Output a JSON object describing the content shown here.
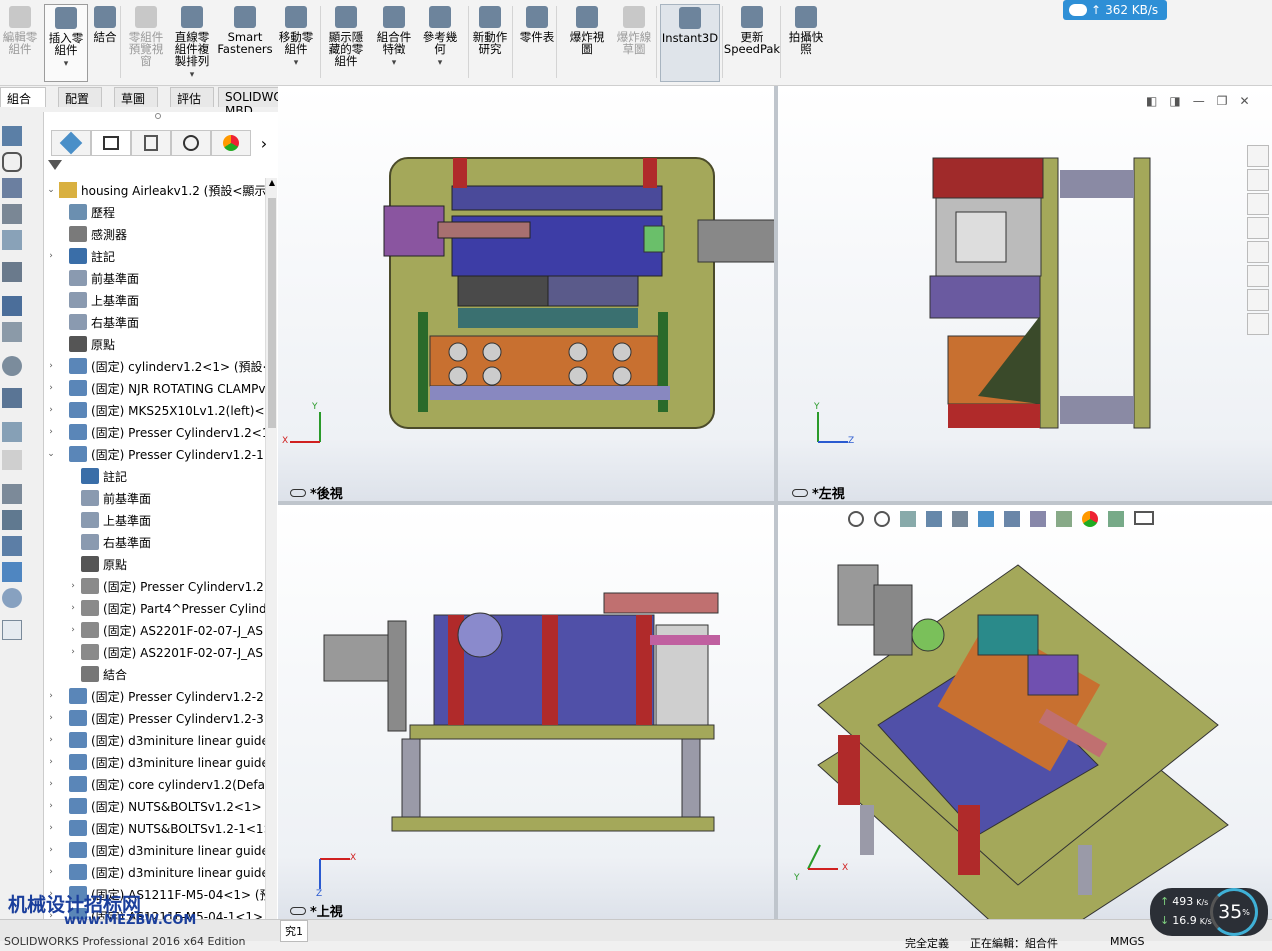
{
  "ribbon": {
    "buttons": [
      {
        "label": "編輯零\n組件",
        "icon": "edit-component-icon",
        "disabled": true
      },
      {
        "label": "插入零\n組件",
        "icon": "insert-component-icon",
        "disabled": false
      },
      {
        "label": "結合",
        "icon": "mate-icon",
        "disabled": false
      },
      {
        "label": "零組件\n預覽視\n窗",
        "icon": "component-preview-icon",
        "disabled": true
      },
      {
        "label": "直線零\n組件複\n製排列",
        "icon": "linear-pattern-icon",
        "disabled": false
      },
      {
        "label": "Smart\nFasteners",
        "icon": "smart-fasteners-icon",
        "disabled": false
      },
      {
        "label": "移動零\n組件",
        "icon": "move-component-icon",
        "disabled": false
      },
      {
        "label": "顯示隱\n藏的零\n組件",
        "icon": "show-hidden-icon",
        "disabled": false
      },
      {
        "label": "組合件\n特徵",
        "icon": "assembly-feature-icon",
        "disabled": false
      },
      {
        "label": "參考幾\n何",
        "icon": "reference-geometry-icon",
        "disabled": false
      },
      {
        "label": "新動作\n研究",
        "icon": "motion-study-icon",
        "disabled": false
      },
      {
        "label": "零件表",
        "icon": "bom-icon",
        "disabled": false
      },
      {
        "label": "爆炸視\n圖",
        "icon": "exploded-view-icon",
        "disabled": false
      },
      {
        "label": "爆炸線\n草圖",
        "icon": "explode-line-icon",
        "disabled": true
      },
      {
        "label": "Instant3D",
        "icon": "instant3d-icon",
        "disabled": false
      },
      {
        "label": "更新\nSpeedPak",
        "icon": "speedpak-icon",
        "disabled": false
      },
      {
        "label": "拍攝快\n照",
        "icon": "snapshot-icon",
        "disabled": false
      }
    ],
    "net_speed": "362 KB/s"
  },
  "tabs": [
    "組合件",
    "配置",
    "草圖",
    "評估",
    "SOLIDWORKS MBD"
  ],
  "tree": {
    "root": "housing Airleakv1.2 (預設<顯示狀態",
    "nodes": [
      {
        "label": "歷程",
        "icon": "history-icon",
        "level": 1
      },
      {
        "label": "感測器",
        "icon": "sensor-icon",
        "level": 1
      },
      {
        "label": "註記",
        "icon": "annotation-icon",
        "level": 1,
        "exp": "›"
      },
      {
        "label": "前基準面",
        "icon": "plane-icon",
        "level": 1
      },
      {
        "label": "上基準面",
        "icon": "plane-icon",
        "level": 1
      },
      {
        "label": "右基準面",
        "icon": "plane-icon",
        "level": 1
      },
      {
        "label": "原點",
        "icon": "origin-icon",
        "level": 1
      },
      {
        "label": "(固定) cylinderv1.2<1> (預設<顯",
        "icon": "part-icon",
        "level": 1,
        "exp": "›"
      },
      {
        "label": "(固定) NJR ROTATING CLAMPv",
        "icon": "part-icon",
        "level": 1,
        "exp": "›"
      },
      {
        "label": "(固定) MKS25X10Lv1.2(left)<1>",
        "icon": "part-icon",
        "level": 1,
        "exp": "›"
      },
      {
        "label": "(固定) Presser Cylinderv1.2<1>",
        "icon": "part-icon",
        "level": 1,
        "exp": "›"
      },
      {
        "label": "(固定) Presser Cylinderv1.2-1<1",
        "icon": "part-icon",
        "level": 1,
        "exp": "⌄"
      },
      {
        "label": "註記",
        "icon": "annotation-icon",
        "level": 2
      },
      {
        "label": "前基準面",
        "icon": "plane-icon",
        "level": 2
      },
      {
        "label": "上基準面",
        "icon": "plane-icon",
        "level": 2
      },
      {
        "label": "右基準面",
        "icon": "plane-icon",
        "level": 2
      },
      {
        "label": "原點",
        "icon": "origin-icon",
        "level": 2
      },
      {
        "label": "(固定) Presser Cylinderv1.2<",
        "icon": "subpart-icon",
        "level": 2,
        "exp": "›"
      },
      {
        "label": "(固定) Part4^Presser Cylind",
        "icon": "subpart-icon",
        "level": 2,
        "exp": "›"
      },
      {
        "label": "(固定) AS2201F-02-07-J_AS",
        "icon": "subpart-icon",
        "level": 2,
        "exp": "›"
      },
      {
        "label": "(固定) AS2201F-02-07-J_AS",
        "icon": "subpart-icon",
        "level": 2,
        "exp": "›"
      },
      {
        "label": "結合",
        "icon": "mate-icon",
        "level": 2
      },
      {
        "label": "(固定) Presser Cylinderv1.2-2<1",
        "icon": "part-icon",
        "level": 1,
        "exp": "›"
      },
      {
        "label": "(固定) Presser Cylinderv1.2-3<1",
        "icon": "part-icon",
        "level": 1,
        "exp": "›"
      },
      {
        "label": "(固定) d3miniture linear guide.3",
        "icon": "part-icon",
        "level": 1,
        "exp": "›"
      },
      {
        "label": "(固定) d3miniture linear guide.3",
        "icon": "part-icon",
        "level": 1,
        "exp": "›"
      },
      {
        "label": "(固定) core cylinderv1.2(Default",
        "icon": "part-icon",
        "level": 1,
        "exp": "›"
      },
      {
        "label": "(固定) NUTS&BOLTSv1.2<1> (預",
        "icon": "part-icon",
        "level": 1,
        "exp": "›"
      },
      {
        "label": "(固定) NUTS&BOLTSv1.2-1<1>",
        "icon": "part-icon",
        "level": 1,
        "exp": "›"
      },
      {
        "label": "(固定) d3miniture linear guide.3",
        "icon": "part-icon",
        "level": 1,
        "exp": "›"
      },
      {
        "label": "(固定) d3miniture linear guide.3",
        "icon": "part-icon",
        "level": 1,
        "exp": "›"
      },
      {
        "label": "(固定) AS1211F-M5-04<1> (預設",
        "icon": "part-icon",
        "level": 1,
        "exp": "›"
      },
      {
        "label": "(固定) AS1211F-M5-04-1<1> (",
        "icon": "part-icon",
        "level": 1,
        "exp": "›"
      }
    ]
  },
  "views": {
    "back": "*後視",
    "left": "*左視",
    "top": "*上視"
  },
  "status": {
    "study": "究1",
    "left": "SOLIDWORKS Professional 2016 x64 Edition",
    "mid": "完全定義",
    "edit": "正在編輯：組合件",
    "units": "MMGS"
  },
  "hud": {
    "up": "493",
    "down": "16.9",
    "unit": "K/s",
    "cpu": "35",
    "cpu_unit": "%"
  },
  "watermark": {
    "line1": "机械设计招标网",
    "line2": "www.MEZBW.COM"
  }
}
